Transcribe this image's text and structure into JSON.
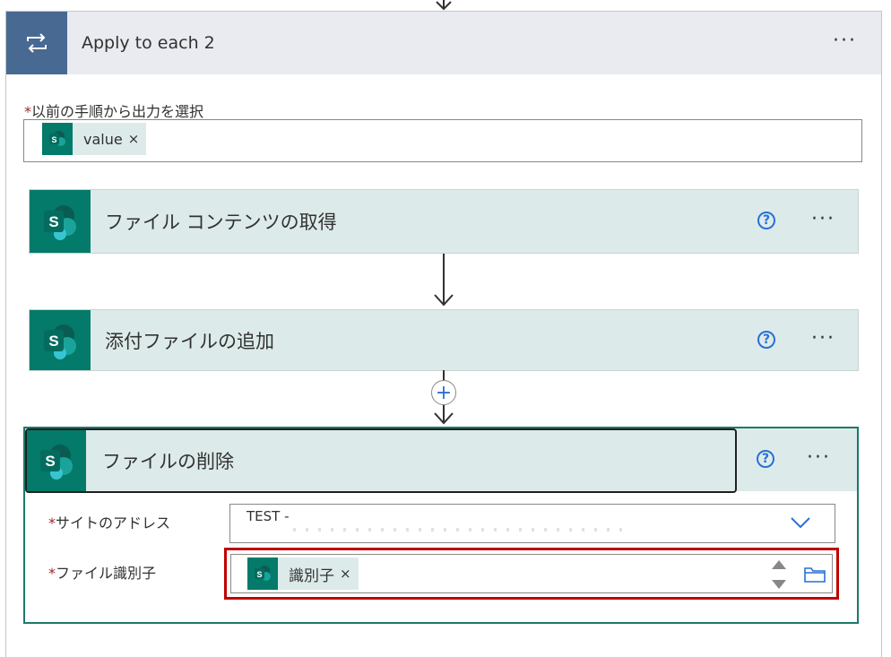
{
  "loop": {
    "title": "Apply to each 2",
    "more_label": "···",
    "icon": "loop-icon"
  },
  "select_field": {
    "label": "以前の手順から出力を選択",
    "required_mark": "*",
    "token": {
      "label": "value",
      "remove": "×",
      "icon": "sharepoint-icon"
    }
  },
  "actions": [
    {
      "title": "ファイル コンテンツの取得",
      "help": "?",
      "more": "···",
      "icon": "sharepoint-icon"
    },
    {
      "title": "添付ファイルの追加",
      "help": "?",
      "more": "···",
      "icon": "sharepoint-icon"
    }
  ],
  "add_step": {
    "label": "+"
  },
  "delete_action": {
    "title": "ファイルの削除",
    "help": "?",
    "more": "···",
    "icon": "sharepoint-icon",
    "fields": {
      "site": {
        "label": "サイトのアドレス",
        "required_mark": "*",
        "value": "TEST -"
      },
      "file_id": {
        "label": "ファイル識別子",
        "required_mark": "*",
        "token": {
          "label": "識別子",
          "remove": "×",
          "icon": "sharepoint-icon"
        }
      }
    }
  },
  "colors": {
    "loop_accent": "#486991",
    "sharepoint": "#037a6a",
    "highlight": "#c00000",
    "help_blue": "#2b6fd6"
  }
}
